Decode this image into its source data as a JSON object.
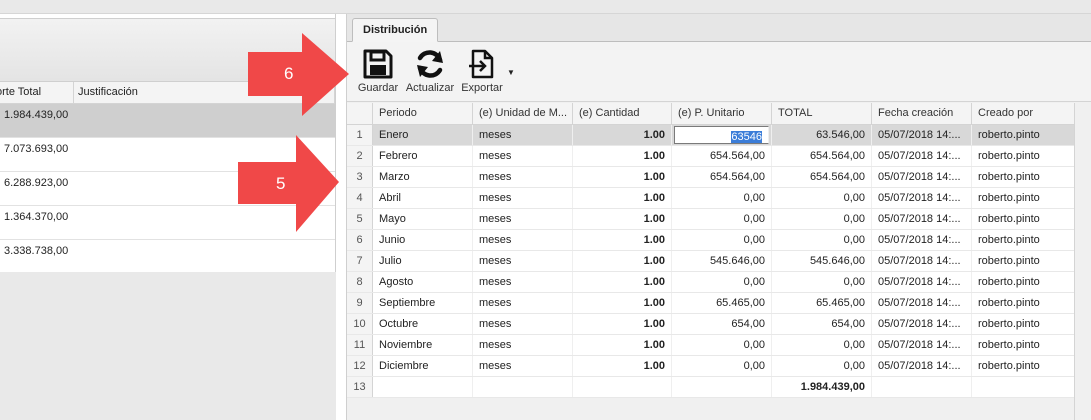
{
  "left_panel": {
    "columns": [
      "orte Total",
      "Justificación"
    ],
    "rows": [
      {
        "importe": "1.984.439,00",
        "justificacion": ""
      },
      {
        "importe": "7.073.693,00",
        "justificacion": ""
      },
      {
        "importe": "6.288.923,00",
        "justificacion": ""
      },
      {
        "importe": "1.364.370,00",
        "justificacion": ""
      },
      {
        "importe": "3.338.738,00",
        "justificacion": ""
      }
    ]
  },
  "tab": {
    "label": "Distribución"
  },
  "toolbar": {
    "guardar_label": "Guardar",
    "actualizar_label": "Actualizar",
    "exportar_label": "Exportar"
  },
  "grid": {
    "columns": [
      "Periodo",
      "(e) Unidad de M...",
      "(e) Cantidad",
      "(e) P. Unitario",
      "TOTAL",
      "Fecha creación",
      "Creado por"
    ],
    "rows": [
      {
        "n": "1",
        "periodo": "Enero",
        "unidad": "meses",
        "cantidad": "1.00",
        "unitario": "63546",
        "total": "63.546,00",
        "fecha": "05/07/2018 14:...",
        "creado": "roberto.pinto"
      },
      {
        "n": "2",
        "periodo": "Febrero",
        "unidad": "meses",
        "cantidad": "1.00",
        "unitario": "654.564,00",
        "total": "654.564,00",
        "fecha": "05/07/2018 14:...",
        "creado": "roberto.pinto"
      },
      {
        "n": "3",
        "periodo": "Marzo",
        "unidad": "meses",
        "cantidad": "1.00",
        "unitario": "654.564,00",
        "total": "654.564,00",
        "fecha": "05/07/2018 14:...",
        "creado": "roberto.pinto"
      },
      {
        "n": "4",
        "periodo": "Abril",
        "unidad": "meses",
        "cantidad": "1.00",
        "unitario": "0,00",
        "total": "0,00",
        "fecha": "05/07/2018 14:...",
        "creado": "roberto.pinto"
      },
      {
        "n": "5",
        "periodo": "Mayo",
        "unidad": "meses",
        "cantidad": "1.00",
        "unitario": "0,00",
        "total": "0,00",
        "fecha": "05/07/2018 14:...",
        "creado": "roberto.pinto"
      },
      {
        "n": "6",
        "periodo": "Junio",
        "unidad": "meses",
        "cantidad": "1.00",
        "unitario": "0,00",
        "total": "0,00",
        "fecha": "05/07/2018 14:...",
        "creado": "roberto.pinto"
      },
      {
        "n": "7",
        "periodo": "Julio",
        "unidad": "meses",
        "cantidad": "1.00",
        "unitario": "545.646,00",
        "total": "545.646,00",
        "fecha": "05/07/2018 14:...",
        "creado": "roberto.pinto"
      },
      {
        "n": "8",
        "periodo": "Agosto",
        "unidad": "meses",
        "cantidad": "1.00",
        "unitario": "0,00",
        "total": "0,00",
        "fecha": "05/07/2018 14:...",
        "creado": "roberto.pinto"
      },
      {
        "n": "9",
        "periodo": "Septiembre",
        "unidad": "meses",
        "cantidad": "1.00",
        "unitario": "65.465,00",
        "total": "65.465,00",
        "fecha": "05/07/2018 14:...",
        "creado": "roberto.pinto"
      },
      {
        "n": "10",
        "periodo": "Octubre",
        "unidad": "meses",
        "cantidad": "1.00",
        "unitario": "654,00",
        "total": "654,00",
        "fecha": "05/07/2018 14:...",
        "creado": "roberto.pinto"
      },
      {
        "n": "11",
        "periodo": "Noviembre",
        "unidad": "meses",
        "cantidad": "1.00",
        "unitario": "0,00",
        "total": "0,00",
        "fecha": "05/07/2018 14:...",
        "creado": "roberto.pinto"
      },
      {
        "n": "12",
        "periodo": "Diciembre",
        "unidad": "meses",
        "cantidad": "1.00",
        "unitario": "0,00",
        "total": "0,00",
        "fecha": "05/07/2018 14:...",
        "creado": "roberto.pinto"
      }
    ],
    "total_row": {
      "n": "13",
      "total": "1.984.439,00"
    }
  },
  "callouts": [
    {
      "label": "6",
      "color": "#f04848"
    },
    {
      "label": "5",
      "color": "#f04848"
    }
  ],
  "colors": {
    "accent_selection": "#3b7dd8",
    "callout": "#f04848"
  }
}
